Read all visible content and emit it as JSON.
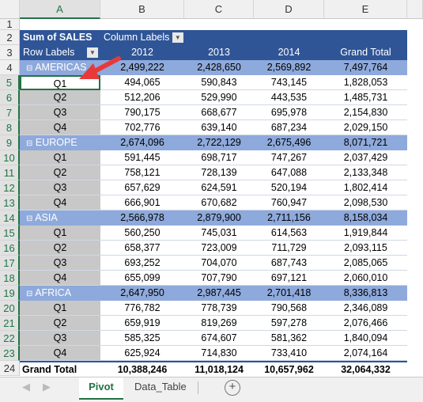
{
  "columns": [
    "A",
    "B",
    "C",
    "D",
    "E"
  ],
  "pivot": {
    "value_field": "Sum of SALES",
    "column_labels": "Column Labels",
    "row_labels": "Row Labels",
    "years": [
      "2012",
      "2013",
      "2014",
      "Grand Total"
    ],
    "groups": [
      {
        "name": "AMERICAS",
        "totals": [
          "2,499,222",
          "2,428,650",
          "2,569,892",
          "7,497,764"
        ],
        "rows": [
          [
            "Q1",
            "494,065",
            "590,843",
            "743,145",
            "1,828,053"
          ],
          [
            "Q2",
            "512,206",
            "529,990",
            "443,535",
            "1,485,731"
          ],
          [
            "Q3",
            "790,175",
            "668,677",
            "695,978",
            "2,154,830"
          ],
          [
            "Q4",
            "702,776",
            "639,140",
            "687,234",
            "2,029,150"
          ]
        ]
      },
      {
        "name": "EUROPE",
        "totals": [
          "2,674,096",
          "2,722,129",
          "2,675,496",
          "8,071,721"
        ],
        "rows": [
          [
            "Q1",
            "591,445",
            "698,717",
            "747,267",
            "2,037,429"
          ],
          [
            "Q2",
            "758,121",
            "728,139",
            "647,088",
            "2,133,348"
          ],
          [
            "Q3",
            "657,629",
            "624,591",
            "520,194",
            "1,802,414"
          ],
          [
            "Q4",
            "666,901",
            "670,682",
            "760,947",
            "2,098,530"
          ]
        ]
      },
      {
        "name": "ASIA",
        "totals": [
          "2,566,978",
          "2,879,900",
          "2,711,156",
          "8,158,034"
        ],
        "rows": [
          [
            "Q1",
            "560,250",
            "745,031",
            "614,563",
            "1,919,844"
          ],
          [
            "Q2",
            "658,377",
            "723,009",
            "711,729",
            "2,093,115"
          ],
          [
            "Q3",
            "693,252",
            "704,070",
            "687,743",
            "2,085,065"
          ],
          [
            "Q4",
            "655,099",
            "707,790",
            "697,121",
            "2,060,010"
          ]
        ]
      },
      {
        "name": "AFRICA",
        "totals": [
          "2,647,950",
          "2,987,445",
          "2,701,418",
          "8,336,813"
        ],
        "rows": [
          [
            "Q1",
            "776,782",
            "778,739",
            "790,568",
            "2,346,089"
          ],
          [
            "Q2",
            "659,919",
            "819,269",
            "597,278",
            "2,076,466"
          ],
          [
            "Q3",
            "585,325",
            "674,607",
            "581,362",
            "1,840,094"
          ],
          [
            "Q4",
            "625,924",
            "714,830",
            "733,410",
            "2,074,164"
          ]
        ]
      }
    ],
    "grand_total": {
      "label": "Grand Total",
      "values": [
        "10,388,246",
        "11,018,124",
        "10,657,962",
        "32,064,332"
      ]
    }
  },
  "selected_cell": "A5",
  "sheet_tabs": [
    {
      "label": "Pivot",
      "active": true
    },
    {
      "label": "Data_Table",
      "active": false
    }
  ],
  "colors": {
    "header": "#2f5597",
    "region": "#8ea9db",
    "row_label": "#c8c8c8",
    "accent": "#217346",
    "arrow": "#e8393a"
  }
}
